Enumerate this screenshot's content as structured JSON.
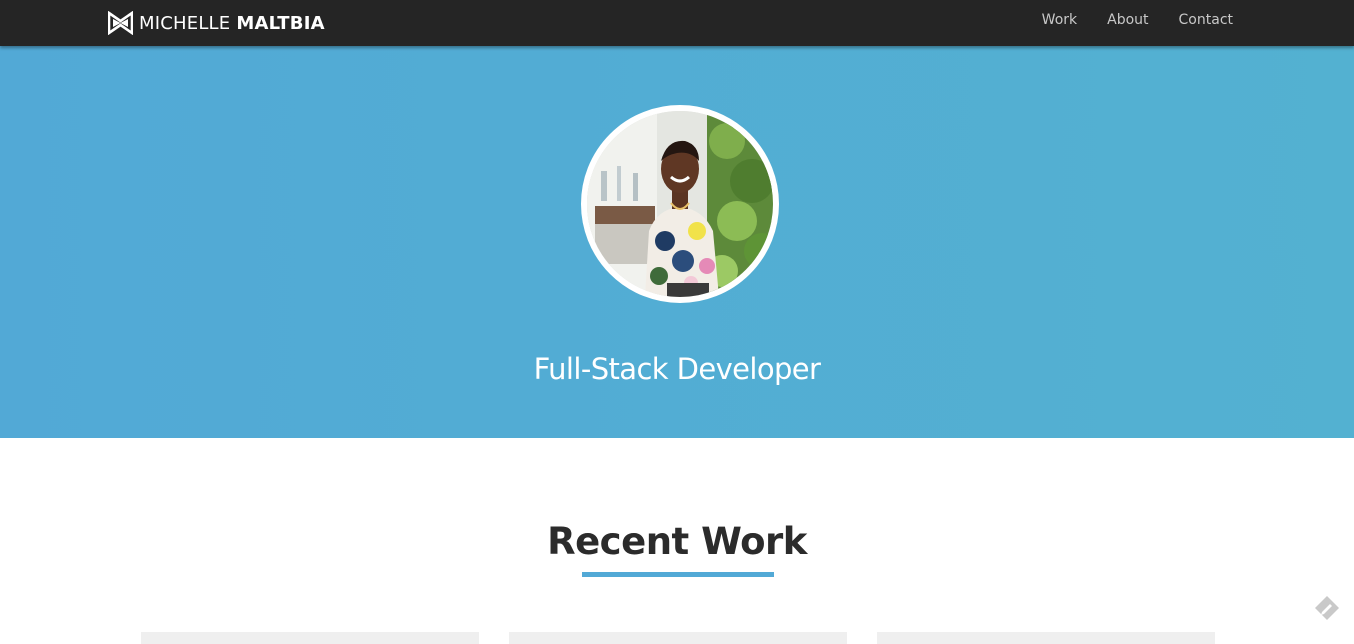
{
  "brand": {
    "first_name": "MICHELLE",
    "last_name": "MALTBIA",
    "logo_icon": "mm-bowtie-logo-icon"
  },
  "nav": {
    "items": [
      {
        "label": "Work"
      },
      {
        "label": "About"
      },
      {
        "label": "Contact"
      }
    ]
  },
  "hero": {
    "title": "Full-Stack Developer",
    "avatar_icon": "profile-photo",
    "background_color": "#52a9d6"
  },
  "recent_work": {
    "title": "Recent Work",
    "underline_color": "#52a9d6",
    "cards_visible": 3
  },
  "floating_widget": {
    "icon": "feedback-pencil-icon"
  },
  "colors": {
    "navbar": "#252525",
    "accent": "#52a9d6",
    "heading": "#2b2b2b"
  }
}
